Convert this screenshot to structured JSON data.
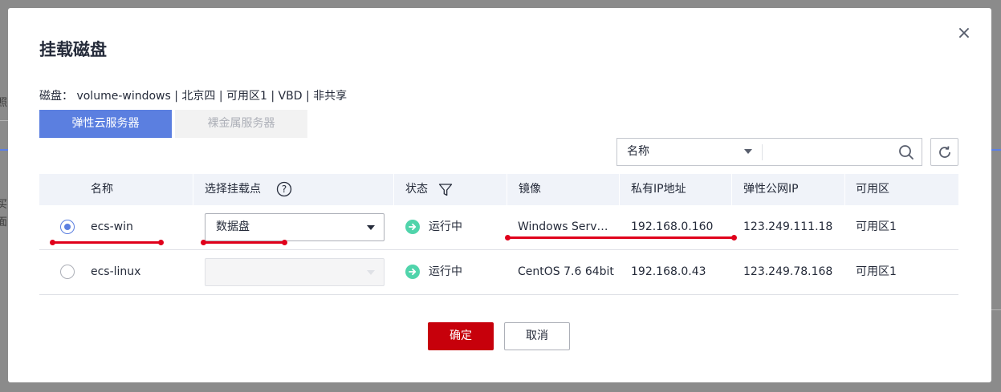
{
  "dialog": {
    "title": "挂载磁盘",
    "close_label": "×",
    "disk_info": "磁盘：  volume-windows  | 北京四 | 可用区1 | VBD | 非共享"
  },
  "tabs": [
    {
      "label": "弹性云服务器",
      "active": true
    },
    {
      "label": "裸金属服务器",
      "active": false
    }
  ],
  "search": {
    "field": "名称",
    "value": ""
  },
  "table": {
    "headers": {
      "name": "名称",
      "mount_point": "选择挂载点",
      "status": "状态",
      "image": "镜像",
      "private_ip": "私有IP地址",
      "eip": "弹性公网IP",
      "az": "可用区"
    },
    "rows": [
      {
        "selected": true,
        "name": "ecs-win",
        "mount_point": "数据盘",
        "mount_enabled": true,
        "status": "运行中",
        "image": "Windows Serv…",
        "private_ip": "192.168.0.160",
        "eip": "123.249.111.18",
        "az": "可用区1"
      },
      {
        "selected": false,
        "name": "ecs-linux",
        "mount_point": "",
        "mount_enabled": false,
        "status": "运行中",
        "image": "CentOS 7.6 64bit",
        "private_ip": "192.168.0.43",
        "eip": "123.249.78.168",
        "az": "可用区1"
      }
    ]
  },
  "footer": {
    "ok_label": "确定",
    "cancel_label": "取消"
  },
  "background": {
    "chars": [
      "照",
      "买",
      "面"
    ]
  },
  "colors": {
    "primary_button": "#c7000b",
    "tab_active": "#5b7fe0",
    "status_running": "#50d4ab",
    "annotation": "#e0001b"
  }
}
